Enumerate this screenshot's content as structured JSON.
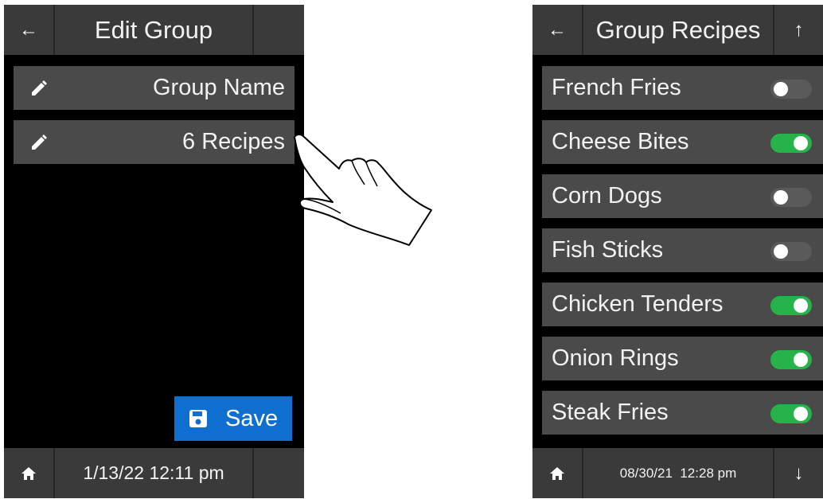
{
  "edit_group": {
    "title": "Edit Group",
    "back_icon": "←",
    "group_name_label": "Group Name",
    "recipes_label": "6 Recipes",
    "save_label": "Save",
    "datetime": "1/13/22 12:11 pm"
  },
  "group_recipes": {
    "title": "Group Recipes",
    "back_icon": "←",
    "scroll_up_icon": "↑",
    "scroll_down_icon": "↓",
    "datetime": "08/30/21  12:28 pm",
    "recipes": [
      {
        "label": "French Fries",
        "enabled": false
      },
      {
        "label": "Cheese Bites",
        "enabled": true
      },
      {
        "label": "Corn Dogs",
        "enabled": false
      },
      {
        "label": "Fish Sticks",
        "enabled": false
      },
      {
        "label": "Chicken Tenders",
        "enabled": true
      },
      {
        "label": "Onion Rings",
        "enabled": true
      },
      {
        "label": "Steak Fries",
        "enabled": true
      }
    ]
  },
  "colors": {
    "toggle_on": "#26b34a",
    "toggle_off": "#5a5a5a",
    "save_button": "#0f6fd0",
    "bar": "#3a3a3a",
    "row": "#4a4a4a"
  }
}
